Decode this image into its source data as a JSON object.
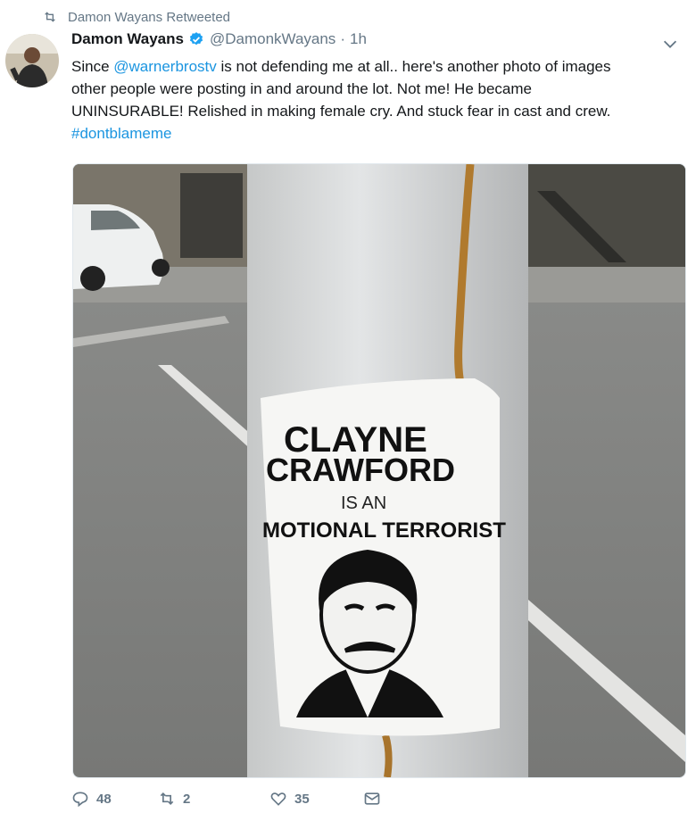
{
  "retweet_banner": {
    "label": "Damon Wayans Retweeted",
    "icon": "retweet-icon"
  },
  "tweet": {
    "author_name": "Damon Wayans",
    "verified": true,
    "handle": "@DamonkWayans",
    "separator": "·",
    "time": "1h",
    "text": {
      "line1_prefix": "Since ",
      "line1_mention": "@warnerbrostv",
      "line1_suffix": " is not defending me at all.. here's another photo of images",
      "line2": "other people were posting in and around the lot.  Not me!  He became",
      "line3": "UNINSURABLE!  Relished in making female cry. And stuck fear in cast and crew.",
      "hashtag": "#dontblameme"
    },
    "photo": {
      "poster_line1": "CLAYNE",
      "poster_line2": "CRAWFORD",
      "poster_line3": "IS AN",
      "poster_line4": "MOTIONAL TERRORIST"
    }
  },
  "actions": {
    "replies": "48",
    "retweets": "2",
    "likes": "35"
  },
  "colors": {
    "link": "#1b95e0",
    "muted": "#657786",
    "verified": "#1da1f2"
  }
}
